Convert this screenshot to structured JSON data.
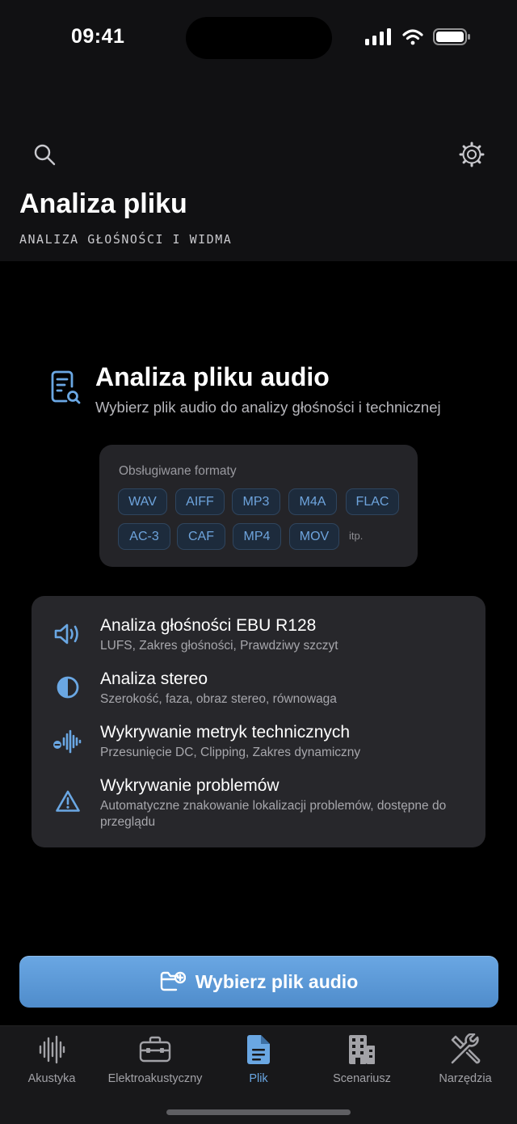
{
  "status_bar": {
    "time": "09:41"
  },
  "header": {
    "title": "Analiza pliku",
    "subtitle": "ANALIZA GŁOŚNOŚCI I WIDMA"
  },
  "hero": {
    "title": "Analiza pliku audio",
    "subtitle": "Wybierz plik audio do analizy głośności i technicznej"
  },
  "formats": {
    "label": "Obsługiwane formaty",
    "items": [
      "WAV",
      "AIFF",
      "MP3",
      "M4A",
      "FLAC",
      "AC-3",
      "CAF",
      "MP4",
      "MOV"
    ],
    "etc": "itp."
  },
  "features": [
    {
      "icon": "speaker-icon",
      "title": "Analiza głośności EBU R128",
      "description": "LUFS, Zakres głośności, Prawdziwy szczyt"
    },
    {
      "icon": "half-circle-icon",
      "title": "Analiza stereo",
      "description": "Szerokość, faza, obraz stereo, równowaga"
    },
    {
      "icon": "waveform-icon",
      "title": "Wykrywanie metryk technicznych",
      "description": "Przesunięcie DC, Clipping, Zakres dynamiczny"
    },
    {
      "icon": "warning-icon",
      "title": "Wykrywanie problemów",
      "description": "Automatyczne znakowanie lokalizacji problemów, dostępne do przeglądu"
    }
  ],
  "primary_button": {
    "label": "Wybierz plik audio",
    "icon": "folder-add-icon"
  },
  "tabs": [
    {
      "label": "Akustyka",
      "icon": "waveform-icon",
      "active": false
    },
    {
      "label": "Elektroakustyczny",
      "icon": "toolbox-icon",
      "active": false
    },
    {
      "label": "Plik",
      "icon": "document-icon",
      "active": true
    },
    {
      "label": "Scenariusz",
      "icon": "building-icon",
      "active": false
    },
    {
      "label": "Narzędzia",
      "icon": "tools-icon",
      "active": false
    }
  ],
  "colors": {
    "accent": "#6aa7e3",
    "background": "#000000",
    "card": "#27272b",
    "header": "#111113"
  }
}
